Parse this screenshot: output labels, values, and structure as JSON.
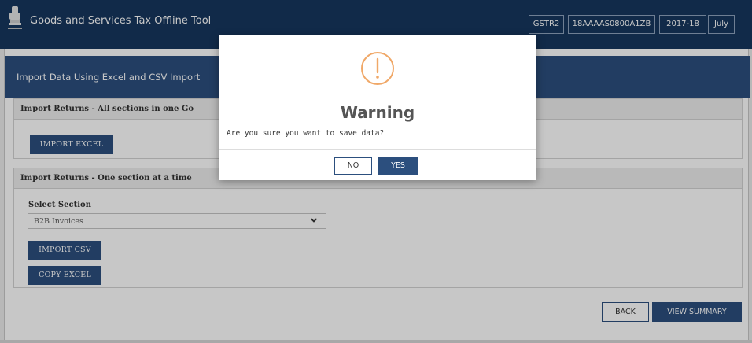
{
  "header": {
    "app_title": "Goods and Services Tax Offline Tool",
    "emblem_icon": "national-emblem-icon",
    "context": {
      "return_type": "GSTR2",
      "gstin": "18AAAAS0800A1ZB",
      "financial_year": "2017-18",
      "month": "July"
    }
  },
  "page": {
    "title": "Import Data Using Excel and CSV Import",
    "panel_all": {
      "heading": "Import Returns - All sections in one Go",
      "import_excel_label": "IMPORT EXCEL"
    },
    "panel_section": {
      "heading": "Import Returns - One section at a time",
      "select_label": "Select Section",
      "select_value": "B2B Invoices",
      "import_csv_label": "IMPORT CSV",
      "copy_excel_label": "COPY EXCEL"
    },
    "back_label": "BACK",
    "view_summary_label": "VIEW SUMMARY"
  },
  "modal": {
    "icon": "warning-icon",
    "title": "Warning",
    "message": "Are you sure you want to save data?",
    "no_label": "NO",
    "yes_label": "YES"
  },
  "colors": {
    "header_bg": "#17375e",
    "accent": "#2c4f7e",
    "warning": "#f0a868"
  }
}
